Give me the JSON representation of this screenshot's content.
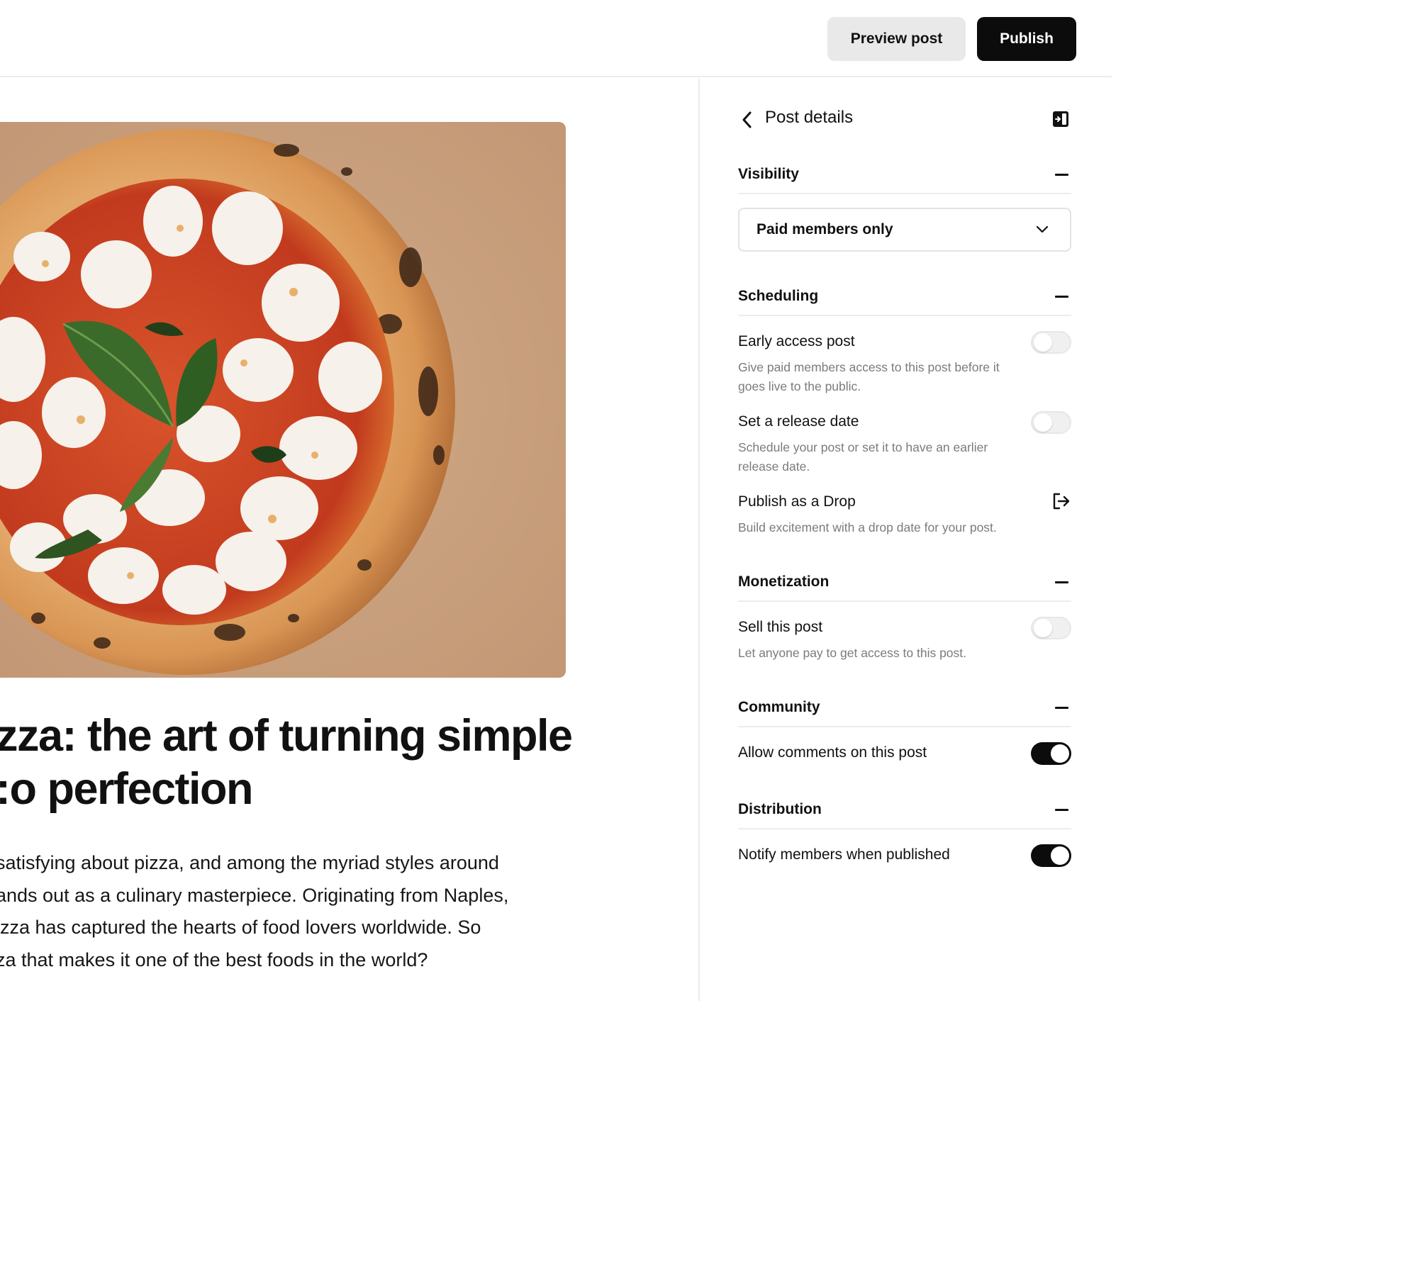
{
  "toolbar": {
    "preview_label": "Preview post",
    "publish_label": "Publish"
  },
  "post": {
    "title": "zza: the art of turning simple\n:o perfection",
    "body_lines": [
      "satisfying about pizza, and among the myriad styles around",
      "ands out as a culinary masterpiece. Originating from Naples,",
      "izza has captured the hearts of food lovers worldwide. So",
      "za that makes it one of the best foods in the world?"
    ]
  },
  "panel": {
    "title": "Post details",
    "visibility": {
      "heading": "Visibility",
      "selected": "Paid members only"
    },
    "scheduling": {
      "heading": "Scheduling",
      "early_access": {
        "label": "Early access post",
        "description": "Give paid members access to this post before it goes live to the public.",
        "enabled": false
      },
      "release_date": {
        "label": "Set a release date",
        "description": "Schedule your post or set it to have an earlier release date.",
        "enabled": false
      },
      "drop": {
        "label": "Publish as a Drop",
        "description": "Build excitement with a drop date for your post."
      }
    },
    "monetization": {
      "heading": "Monetization",
      "sell": {
        "label": "Sell this post",
        "description": "Let anyone pay to get access to this post.",
        "enabled": false
      }
    },
    "community": {
      "heading": "Community",
      "comments": {
        "label": "Allow comments on this post",
        "enabled": true
      }
    },
    "distribution": {
      "heading": "Distribution",
      "notify": {
        "label": "Notify members when published",
        "enabled": true
      }
    }
  },
  "icons": {
    "back": "chevron-left-icon",
    "collapse": "panel-collapse-icon",
    "dropdown": "chevron-down-icon",
    "drop_link": "arrow-right-from-bracket-icon"
  },
  "colors": {
    "publish_bg": "#0c0c0c",
    "preview_bg": "#e9e9e9",
    "toggle_on": "#0c0c0c",
    "toggle_off": "#f0f0f0",
    "muted_text": "#7b7b7b"
  }
}
